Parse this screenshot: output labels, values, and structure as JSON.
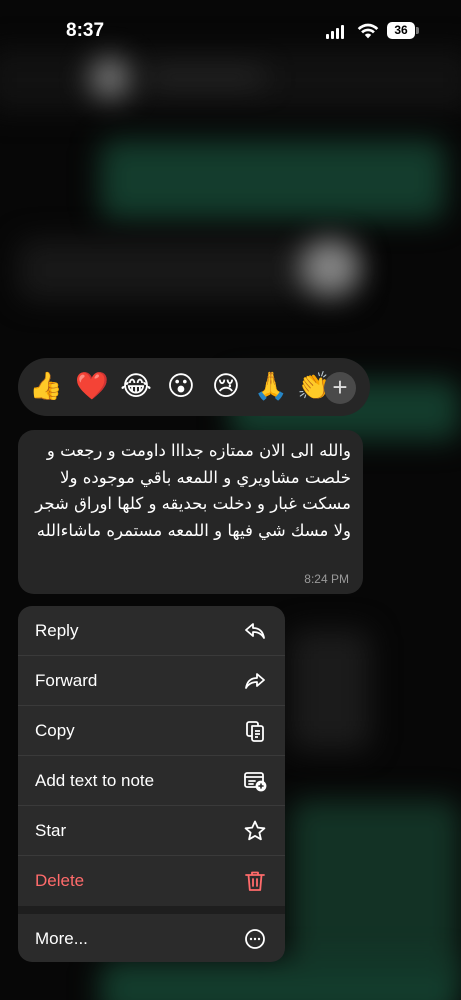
{
  "status_bar": {
    "time": "8:37",
    "battery": "36"
  },
  "reactions": {
    "items": [
      {
        "name": "thumbs-up",
        "glyph": "👍"
      },
      {
        "name": "heart",
        "glyph": "❤️"
      },
      {
        "name": "laughing",
        "glyph": "😂"
      },
      {
        "name": "surprised",
        "glyph": "😮"
      },
      {
        "name": "crying",
        "glyph": "😢"
      },
      {
        "name": "folded-hands",
        "glyph": "🙏"
      },
      {
        "name": "clapping",
        "glyph": "👏"
      }
    ],
    "more": "+"
  },
  "message": {
    "text": "والله الى الان ممتازه جدااا داومت و رجعت و خلصت مشاويري و اللمعه باقي موجوده ولا مسكت غبار و دخلت بحديقه و كلها اوراق شجر ولا مسك شي فيها و اللمعه مستمره ماشاءالله",
    "time": "8:24 PM"
  },
  "menu": {
    "items": [
      {
        "label": "Reply",
        "icon": "reply-icon"
      },
      {
        "label": "Forward",
        "icon": "forward-icon"
      },
      {
        "label": "Copy",
        "icon": "copy-icon"
      },
      {
        "label": "Add text to note",
        "icon": "note-add-icon"
      },
      {
        "label": "Star",
        "icon": "star-icon"
      },
      {
        "label": "Delete",
        "icon": "trash-icon",
        "color": "#ff6b6b"
      },
      {
        "label": "More...",
        "icon": "more-icon"
      }
    ]
  }
}
